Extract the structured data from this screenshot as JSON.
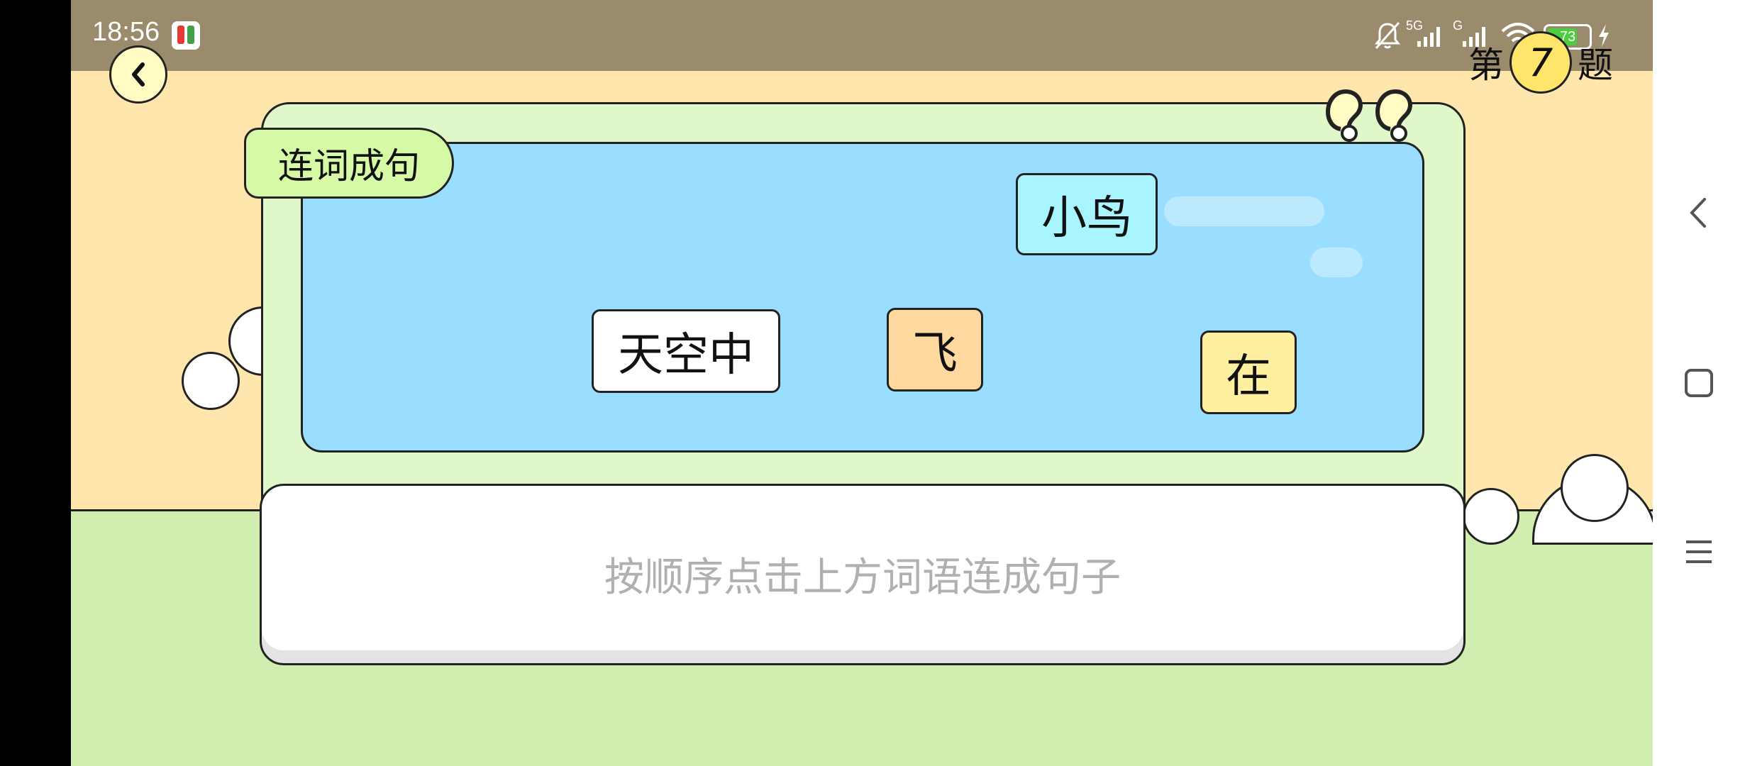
{
  "status_bar": {
    "time": "18:56",
    "network": "5G",
    "network2": "G",
    "battery": "73",
    "battery_level": 0.73,
    "icons": [
      "app-notification-icon",
      "mute-icon",
      "signal-5g-icon",
      "signal-g-icon",
      "wifi-icon",
      "battery-icon",
      "charging-icon"
    ]
  },
  "header": {
    "back_icon": "chevron-left-icon",
    "counter_prefix": "第",
    "counter_number": "7",
    "counter_suffix": "题"
  },
  "exercise": {
    "title": "连词成句",
    "words": [
      {
        "text": "小鸟",
        "color": "#a8f5ff"
      },
      {
        "text": "天空中",
        "color": "#ffffff"
      },
      {
        "text": "飞",
        "color": "#ffd9a0"
      },
      {
        "text": "在",
        "color": "#fff0a0"
      }
    ],
    "answer_placeholder": "按顺序点击上方词语连成句子"
  },
  "navigation_bar": {
    "icons": [
      "back-nav-icon",
      "home-square-icon",
      "menu-lines-icon"
    ]
  }
}
